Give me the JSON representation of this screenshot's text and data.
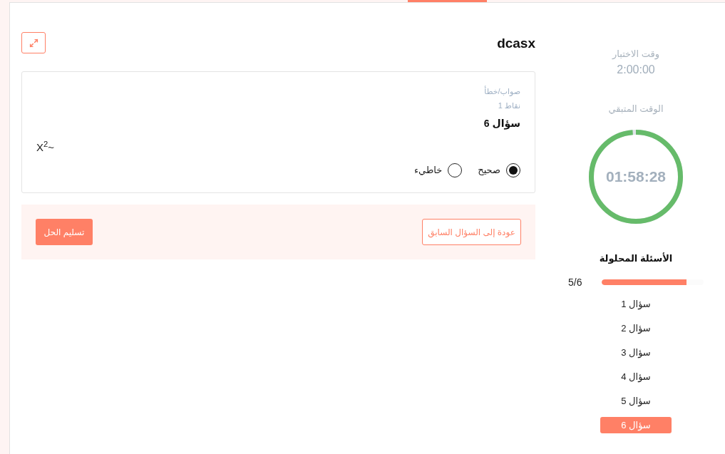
{
  "quiz": {
    "title": "dcasx",
    "question": {
      "type_label": "صواب/خطأ",
      "points": "نقاط 1",
      "title": "سؤال 6",
      "text": "X$^{2}$~",
      "options": [
        {
          "label": "صحيح",
          "selected": true
        },
        {
          "label": "خاطيء",
          "selected": false
        }
      ]
    },
    "actions": {
      "previous": "عودة إلى السؤال السابق",
      "submit": "تسليم الحل"
    }
  },
  "sidebar": {
    "test_time": {
      "label": "وقت الاختبار",
      "value": "2:00:00"
    },
    "remaining_time": {
      "label": "الوقت المتبقي",
      "value": "01:58:28",
      "level": 0.987
    },
    "solved": {
      "title": "الأسئلة المحلولة",
      "count": "5/6",
      "level": 0.833,
      "questions": [
        {
          "label": "سؤال 1",
          "selected": false
        },
        {
          "label": "سؤال 2",
          "selected": false
        },
        {
          "label": "سؤال 3",
          "selected": false
        },
        {
          "label": "سؤال 4",
          "selected": false
        },
        {
          "label": "سؤال 5",
          "selected": false
        },
        {
          "label": "سؤال 6",
          "selected": true
        }
      ]
    }
  }
}
